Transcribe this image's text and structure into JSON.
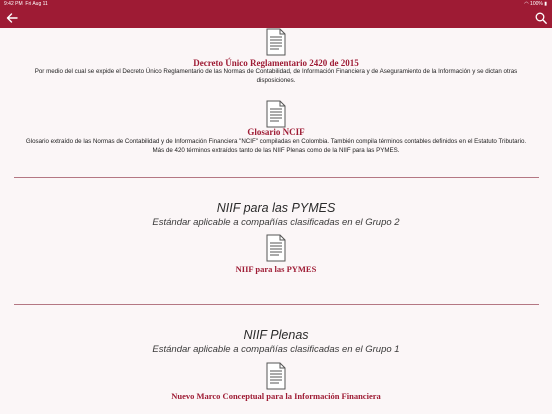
{
  "status_bar": {
    "time": "9:42 PM",
    "date": "Fri Aug 11",
    "battery": "100%"
  },
  "icons": {
    "back": "arrow-left-icon",
    "search": "search-icon",
    "document": "document-icon"
  },
  "colors": {
    "brand": "#9e1b34",
    "background": "#fbf6f7"
  },
  "documents": [
    {
      "title": "Decreto Único Reglamentario 2420 de 2015",
      "description": "Por medio del cual se expide el Decreto Único Reglamentario de las Normas de Contabilidad, de Información Financiera y de Aseguramiento de la Información y se dictan otras disposiciones."
    },
    {
      "title": "Glosario NCIF",
      "description": "Glosario extraído de las Normas de Contabilidad y de Información Financiera \"NCIF\" compiladas en Colombia. También compila términos contables definidos en el Estatuto Tributario. Más de 420 términos extraídos tanto de las NIIF Plenas como de la NIIF para las PYMES."
    }
  ],
  "sections": [
    {
      "title": "NIIF para las PYMES",
      "subtitle": "Estándar aplicable a compañías clasificadas en el Grupo 2",
      "document": "NIIF para las PYMES"
    },
    {
      "title": "NIIF Plenas",
      "subtitle": "Estándar aplicable a compañías clasificadas en el Grupo 1",
      "document": "Nuevo Marco Conceptual para la Información Financiera"
    }
  ]
}
